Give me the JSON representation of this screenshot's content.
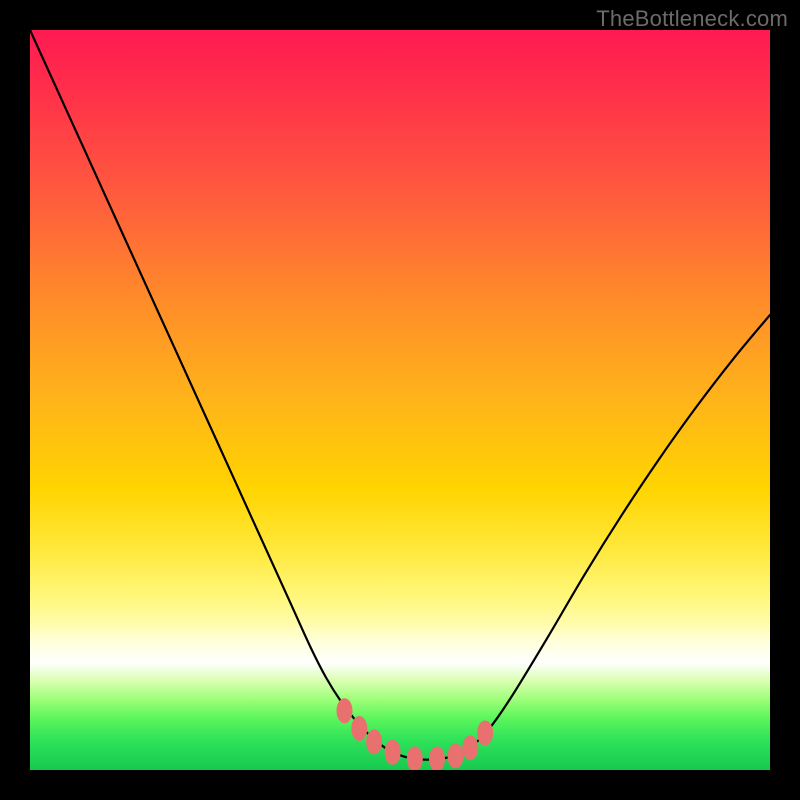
{
  "watermark": {
    "text": "TheBottleneck.com"
  },
  "colors": {
    "curve_stroke": "#000000",
    "marker_fill": "#e8716f",
    "marker_stroke": "#e8716f",
    "green_band": "#2ee25a"
  },
  "chart_data": {
    "type": "line",
    "title": "",
    "xlabel": "",
    "ylabel": "",
    "xlim": [
      0,
      100
    ],
    "ylim": [
      0,
      100
    ],
    "x": [
      0,
      5,
      10,
      15,
      20,
      25,
      30,
      35,
      38,
      40,
      42,
      44,
      46,
      48,
      50,
      52,
      54,
      56,
      58,
      60,
      62,
      65,
      70,
      75,
      80,
      85,
      90,
      95,
      100
    ],
    "y": [
      100,
      89,
      78,
      67,
      56,
      45,
      34,
      23,
      16.4,
      12.5,
      9.3,
      6.7,
      4.6,
      3.0,
      2.0,
      1.5,
      1.4,
      1.6,
      2.2,
      3.5,
      5.5,
      9.8,
      18.0,
      26.5,
      34.5,
      42.0,
      49.0,
      55.5,
      61.5
    ],
    "markers": {
      "x": [
        42.5,
        44.5,
        46.5,
        49.0,
        52.0,
        55.0,
        57.5,
        59.5,
        61.5
      ],
      "y": [
        8.0,
        5.6,
        3.8,
        2.4,
        1.5,
        1.5,
        1.9,
        3.0,
        5.0
      ]
    },
    "notes": "y is chart-up (0 at green bottom, 100 at pink top). The V-shaped black line descends steeply from top-left, flattens near the bottom around x≈50–56, then rises toward the right edge reaching ≈60% height. Salmon capsule markers sit along the trough."
  }
}
